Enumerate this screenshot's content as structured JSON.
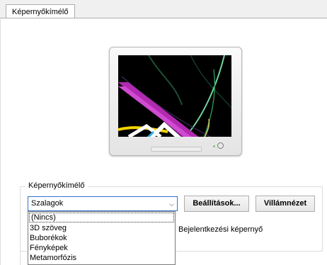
{
  "tabs": [
    {
      "label": "Képernyőkímélő",
      "active": true
    }
  ],
  "group": {
    "title": "Képernyőkímélő"
  },
  "screensaver": {
    "selected": "Szalagok",
    "options": [
      "(Nincs)",
      "3D szöveg",
      "Buborékok",
      "Fényképek",
      "Metamorfózis"
    ]
  },
  "buttons": {
    "settings": "Beállítások...",
    "preview": "Villámnézet"
  },
  "logon": {
    "label": "Bejelentkezési képernyő"
  },
  "icons": {
    "dropdown": "chevron-down-icon",
    "power": "power-button-icon"
  }
}
